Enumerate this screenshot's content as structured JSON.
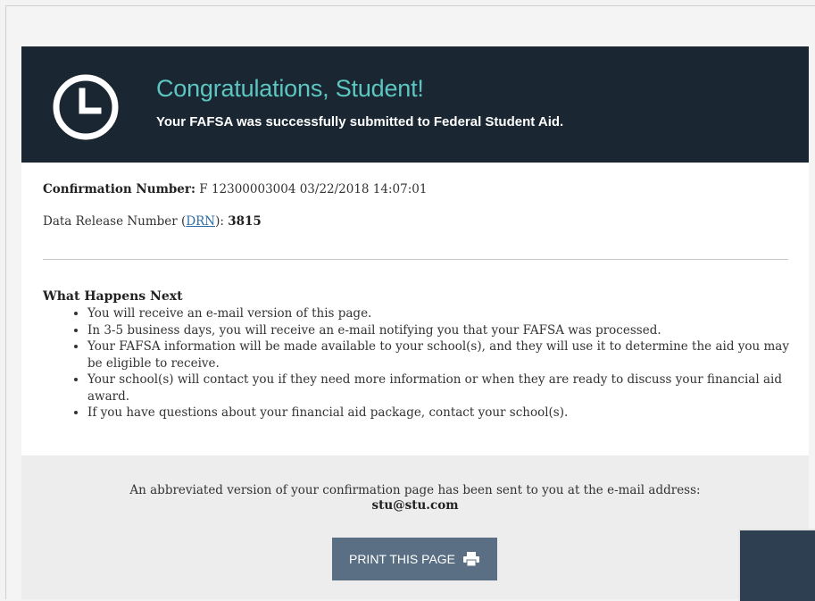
{
  "banner": {
    "title": "Congratulations, Student!",
    "subtitle": "Your FAFSA was successfully submitted to Federal Student Aid.",
    "icon": "clock-icon"
  },
  "confirmation": {
    "label": "Confirmation Number:",
    "value": "F 12300003004 03/22/2018 14:07:01"
  },
  "drn": {
    "label_prefix": "Data Release Number (",
    "link_text": "DRN",
    "label_suffix": "):",
    "value": "3815"
  },
  "next": {
    "heading": "What Happens Next",
    "items": [
      "You will receive an e-mail version of this page.",
      "In 3-5 business days, you will receive an e-mail notifying you that your FAFSA was processed.",
      "Your FAFSA information will be made available to your school(s), and they will use it to determine the aid you may be eligible to receive.",
      "Your school(s) will contact you if they need more information or when they are ready to discuss your financial aid award.",
      "If you have questions about your financial aid package, contact your school(s)."
    ]
  },
  "footer": {
    "text": "An abbreviated version of your confirmation page has been sent to you at the e-mail address:",
    "email": "stu@stu.com",
    "print_label": "PRINT THIS PAGE",
    "print_icon": "printer-icon"
  },
  "colors": {
    "banner_bg": "#1a2632",
    "title": "#5cc6c1",
    "button": "#5a6f83"
  }
}
